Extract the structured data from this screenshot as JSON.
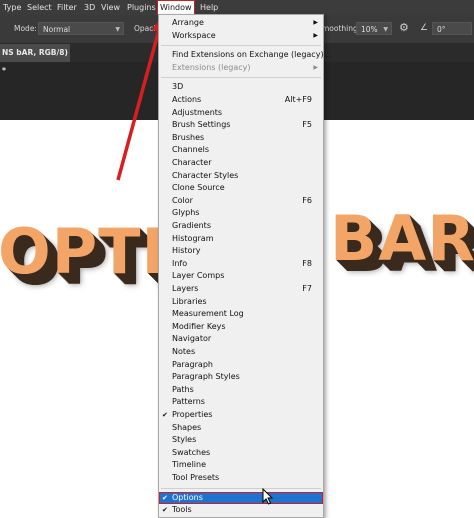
{
  "menubar": {
    "items": [
      "Type",
      "Select",
      "Filter",
      "3D",
      "View",
      "Plugins",
      "Window",
      "Help"
    ],
    "active": "Window"
  },
  "options_bar": {
    "mode_label": "Mode:",
    "mode_value": "Normal",
    "opacity_label": "Opacit",
    "smoothing_label": "moothing:",
    "smoothing_value": "10%",
    "angle_value": "0°"
  },
  "document_tab": {
    "title": "NS bAR, RGB/8) *"
  },
  "canvas": {
    "text_left": "OPTI",
    "text_right": "BAR"
  },
  "window_menu": {
    "items": [
      {
        "label": "Arrange",
        "submenu": true
      },
      {
        "label": "Workspace",
        "submenu": true
      },
      {
        "separator": true
      },
      {
        "label": "Find Extensions on Exchange (legacy)..."
      },
      {
        "label": "Extensions (legacy)",
        "submenu": true,
        "disabled": true
      },
      {
        "separator": true
      },
      {
        "label": "3D"
      },
      {
        "label": "Actions",
        "shortcut": "Alt+F9"
      },
      {
        "label": "Adjustments"
      },
      {
        "label": "Brush Settings",
        "shortcut": "F5"
      },
      {
        "label": "Brushes"
      },
      {
        "label": "Channels"
      },
      {
        "label": "Character"
      },
      {
        "label": "Character Styles"
      },
      {
        "label": "Clone Source"
      },
      {
        "label": "Color",
        "shortcut": "F6"
      },
      {
        "label": "Glyphs"
      },
      {
        "label": "Gradients"
      },
      {
        "label": "Histogram"
      },
      {
        "label": "History"
      },
      {
        "label": "Info",
        "shortcut": "F8"
      },
      {
        "label": "Layer Comps"
      },
      {
        "label": "Layers",
        "shortcut": "F7"
      },
      {
        "label": "Libraries"
      },
      {
        "label": "Measurement Log"
      },
      {
        "label": "Modifier Keys"
      },
      {
        "label": "Navigator"
      },
      {
        "label": "Notes"
      },
      {
        "label": "Paragraph"
      },
      {
        "label": "Paragraph Styles"
      },
      {
        "label": "Paths"
      },
      {
        "label": "Patterns"
      },
      {
        "label": "Properties",
        "checked": true
      },
      {
        "label": "Shapes"
      },
      {
        "label": "Styles"
      },
      {
        "label": "Swatches"
      },
      {
        "label": "Timeline"
      },
      {
        "label": "Tool Presets"
      },
      {
        "separator": true
      },
      {
        "label": "Options",
        "checked": true,
        "selected": true
      },
      {
        "label": "Tools",
        "checked": true
      }
    ]
  },
  "colors": {
    "highlight": "#1f73d0",
    "annotation_red": "#cc1f1f",
    "text_face": "#f2a566"
  },
  "icons": {
    "check": "checkmark-icon",
    "submenu": "submenu-arrow-icon",
    "settings": "gear-icon",
    "angle": "angle-icon"
  }
}
